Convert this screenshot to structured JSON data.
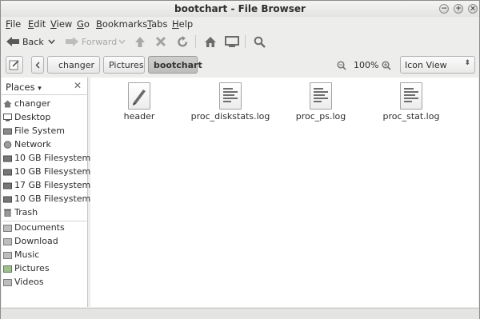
{
  "window": {
    "title": "bootchart - File Browser"
  },
  "menu": [
    "File",
    "Edit",
    "View",
    "Go",
    "Bookmarks",
    "Tabs",
    "Help"
  ],
  "toolbar": {
    "back": "Back",
    "forward": "Forward"
  },
  "location": {
    "path": [
      "changer",
      "Pictures",
      "bootchart"
    ],
    "zoom": "100%",
    "view": "Icon View"
  },
  "sidebar": {
    "title": "Places",
    "places": [
      "changer",
      "Desktop",
      "File System",
      "Network",
      "10 GB Filesystem",
      "10 GB Filesystem",
      "17 GB Filesystem",
      "10 GB Filesystem",
      "Trash"
    ],
    "bookmarks": [
      "Documents",
      "Download",
      "Music",
      "Pictures",
      "Videos"
    ]
  },
  "files": [
    "header",
    "proc_diskstats.log",
    "proc_ps.log",
    "proc_stat.log"
  ]
}
